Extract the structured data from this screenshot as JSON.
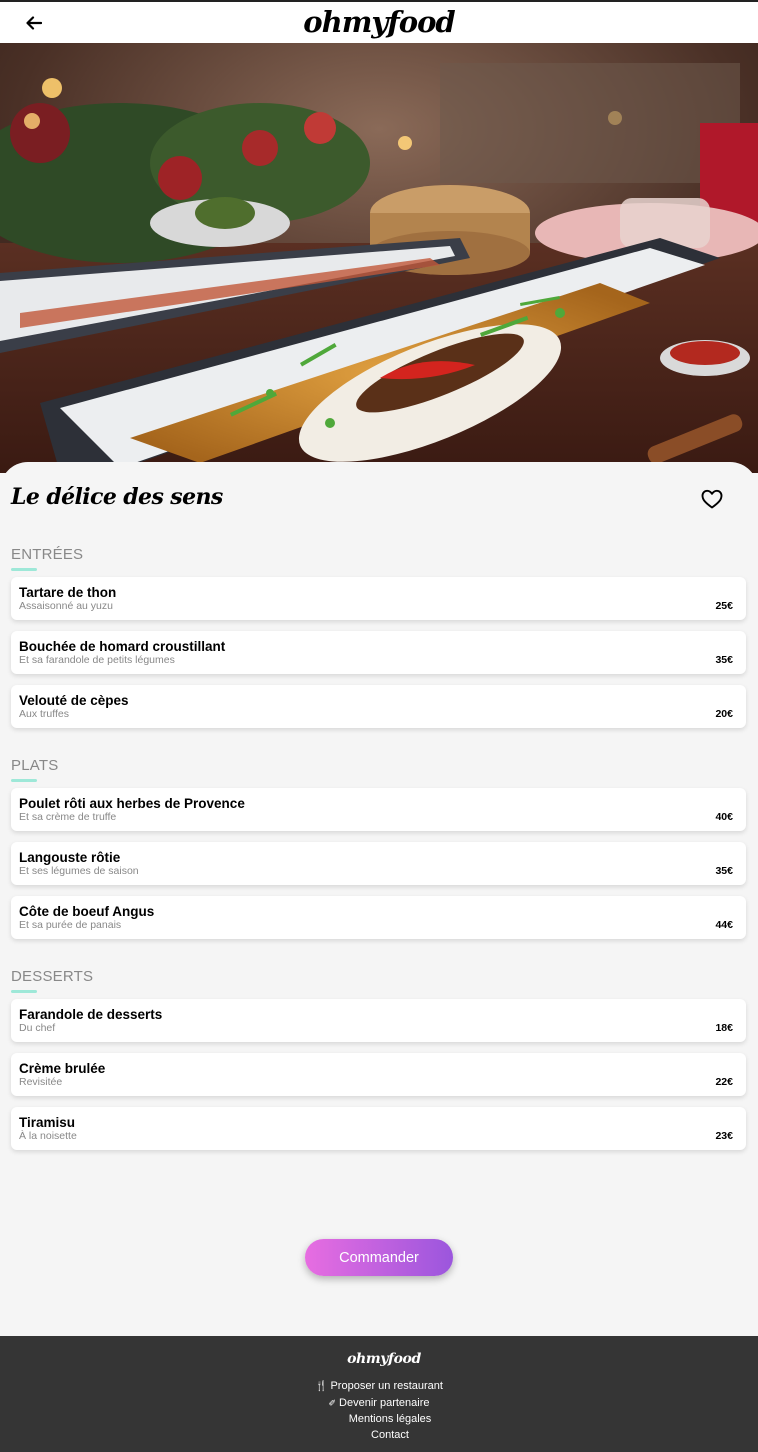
{
  "header": {
    "logo": "ohmyfood"
  },
  "restaurant": {
    "name": "Le délice des sens"
  },
  "sections": [
    {
      "title": "ENTRÉES",
      "dishes": [
        {
          "name": "Tartare de thon",
          "desc": "Assaisonné au yuzu",
          "price": "25€"
        },
        {
          "name": "Bouchée de homard croustillant",
          "desc": "Et sa farandole de petits légumes",
          "price": "35€"
        },
        {
          "name": "Velouté de cèpes",
          "desc": "Aux truffes",
          "price": "20€"
        }
      ]
    },
    {
      "title": "PLATS",
      "dishes": [
        {
          "name": "Poulet rôti aux herbes de Provence",
          "desc": "Et sa crème de truffe",
          "price": "40€"
        },
        {
          "name": "Langouste rôtie",
          "desc": "Et ses légumes de saison",
          "price": "35€"
        },
        {
          "name": "Côte de boeuf Angus",
          "desc": "Et sa purée de panais",
          "price": "44€"
        }
      ]
    },
    {
      "title": "DESSERTS",
      "dishes": [
        {
          "name": "Farandole de desserts",
          "desc": "Du chef",
          "price": "18€"
        },
        {
          "name": "Crème brulée",
          "desc": "Revisitée",
          "price": "22€"
        },
        {
          "name": "Tiramisu",
          "desc": "À la noisette",
          "price": "23€"
        }
      ]
    }
  ],
  "order_button": "Commander",
  "footer": {
    "logo": "ohmyfood",
    "links": [
      "Proposer un restaurant",
      "Devenir partenaire",
      "Mentions légales",
      "Contact"
    ]
  },
  "colors": {
    "accent_gradient_start": "#e76de1",
    "accent_gradient_end": "#9b56dd",
    "section_underline": "#9ee8d8",
    "footer_bg": "#353535"
  }
}
